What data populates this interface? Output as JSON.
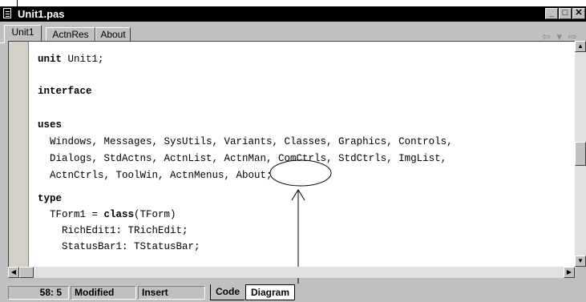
{
  "window": {
    "title": "Unit1.pas",
    "buttons": {
      "minimize": "_",
      "maximize": "□",
      "close": "✕"
    }
  },
  "tabs": [
    {
      "label": "Unit1",
      "active": true
    },
    {
      "label": "ActnRes",
      "active": false
    },
    {
      "label": "About",
      "active": false
    }
  ],
  "nav": {
    "back": "⇦ ▾",
    "forward": "⇨ ▾"
  },
  "code_lines": [
    {
      "kw": "unit",
      "text": " Unit1;"
    },
    {
      "kw": "interface",
      "text": ""
    },
    {
      "kw": "uses",
      "text": ""
    },
    {
      "kw": "",
      "text": "  Windows, Messages, SysUtils, Variants, Classes, Graphics, Controls,"
    },
    {
      "kw": "",
      "text": "  Dialogs, StdActns, ActnList, ActnMan, ComCtrls, StdCtrls, ImgList,"
    },
    {
      "kw": "",
      "text": "  ActnCtrls, ToolWin, ActnMenus, About;"
    },
    {
      "kw": "type",
      "text": ""
    },
    {
      "kw": "",
      "text": "  TForm1 = ",
      "kw2": "class",
      "text2": "(TForm)"
    },
    {
      "kw": "",
      "text": "    RichEdit1: TRichEdit;"
    },
    {
      "kw": "",
      "text": "    StatusBar1: TStatusBar;"
    }
  ],
  "status": {
    "position": "58:  5",
    "modified": "Modified",
    "mode": "Insert",
    "view_tabs": [
      "Code",
      "Diagram"
    ]
  },
  "icons": [
    "document-icon",
    "back-arrow-icon",
    "forward-arrow-icon",
    "scroll-up-icon",
    "scroll-down-icon",
    "scroll-left-icon",
    "scroll-right-icon"
  ]
}
